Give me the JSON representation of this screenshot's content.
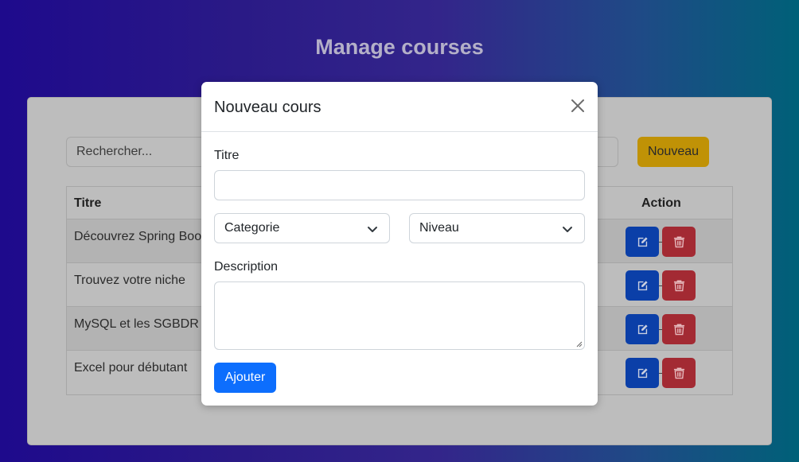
{
  "page": {
    "title": "Manage courses"
  },
  "toolbar": {
    "search_placeholder": "Rechercher...",
    "new_label": "Nouveau"
  },
  "table": {
    "headers": {
      "title": "Titre",
      "action": "Action"
    },
    "rows": [
      {
        "title": "Découvrez Spring Boot"
      },
      {
        "title": "Trouvez votre niche"
      },
      {
        "title": "MySQL et les SGBDR"
      },
      {
        "title": "Excel pour débutant"
      }
    ]
  },
  "modal": {
    "title": "Nouveau cours",
    "titre_label": "Titre",
    "titre_value": "",
    "categorie_select": "Categorie",
    "niveau_select": "Niveau",
    "description_label": "Description",
    "submit_label": "Ajouter"
  },
  "colors": {
    "accent": "#0d6efd",
    "edit": "#0b3fa8",
    "delete": "#a32a33",
    "new_button": "#c09206"
  },
  "icons": [
    "close-icon",
    "chevron-down-icon",
    "edit-icon",
    "trash-icon",
    "resize-handle-icon"
  ]
}
